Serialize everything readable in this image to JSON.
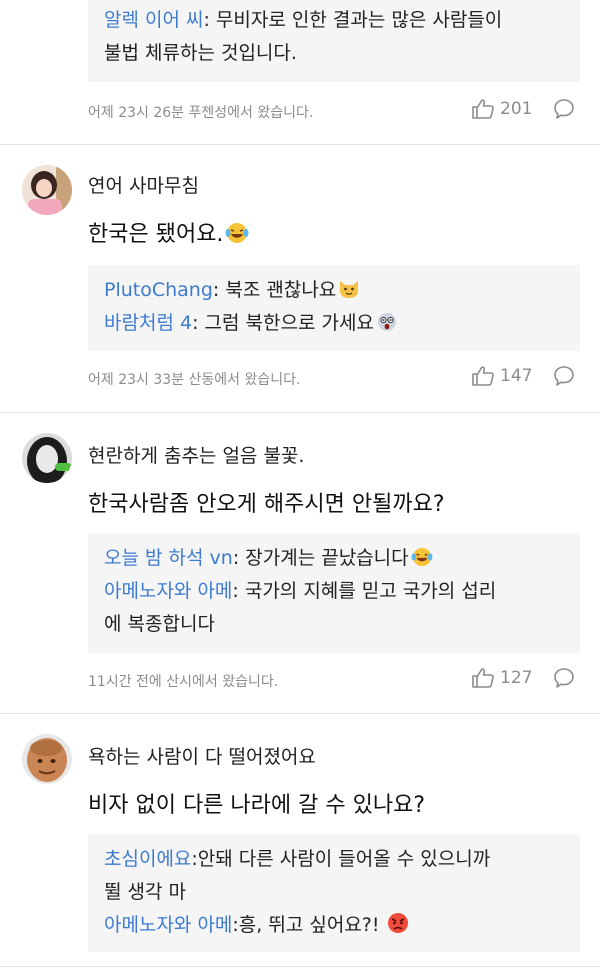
{
  "comments": [
    {
      "replies": [
        {
          "name": "알렉 이어 씨",
          "text": ": 무비자로 인한 결과는 많은 사람들이"
        },
        {
          "name": "",
          "text": "불법 체류하는 것입니다."
        }
      ],
      "meta": "어제 23시 26분 푸젠성에서 왔습니다.",
      "likes": "201"
    },
    {
      "username": "연어 사마무침",
      "body": "한국은 됐어요.",
      "body_emoji": "laughing-crying-emoji",
      "replies": [
        {
          "name": "PlutoChang",
          "text": ": 북조 괜찮나요",
          "emoji": "cat-emoji"
        },
        {
          "name": "바람처럼 4",
          "text": ": 그럼 북한으로 가세요",
          "emoji": "shocked-emoji"
        }
      ],
      "meta": "어제 23시 33분 산동에서 왔습니다.",
      "likes": "147"
    },
    {
      "username": "현란하게 춤추는 얼음 불꽃.",
      "body": "한국사람좀 안오게 해주시면 안될까요?",
      "replies": [
        {
          "name": "오늘 밤 하석 vn",
          "text": ": 장가계는 끝났습니다",
          "emoji": "laughing-crying-emoji"
        },
        {
          "name": "아메노자와 아메",
          "text": ": 국가의 지혜를 믿고 국가의 섭리"
        },
        {
          "name": "",
          "text": "에 복종합니다"
        }
      ],
      "meta": "11시간 전에 산시에서 왔습니다.",
      "likes": "127"
    },
    {
      "username": "욕하는 사람이 다 떨어졌어요",
      "body": "비자 없이 다른 나라에 갈 수 있나요?",
      "replies": [
        {
          "name": "초심이에요",
          "text": ":안돼 다른 사람이 들어올 수 있으니까"
        },
        {
          "name": "",
          "text": "뛸 생각 마"
        },
        {
          "name": "아메노자와 아메",
          "text": ":흥, 뛰고 싶어요?!",
          "emoji": "angry-emoji"
        }
      ]
    }
  ],
  "colors": {
    "reply_name": "#3d7bd1",
    "reply_bg": "#f5f5f5",
    "meta": "#8c8c8c"
  }
}
